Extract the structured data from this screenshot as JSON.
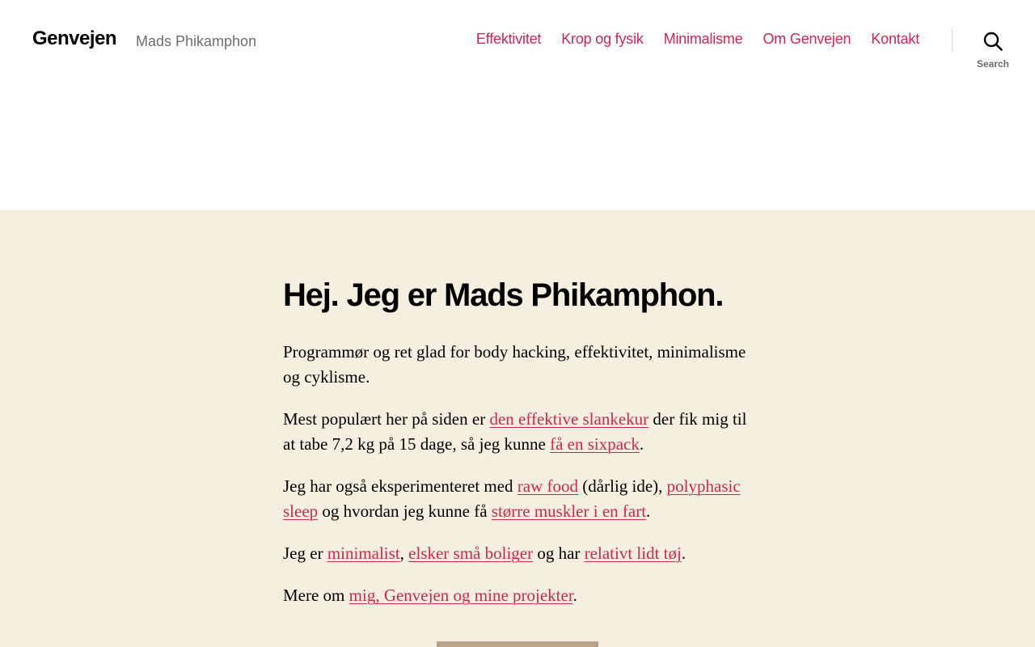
{
  "header": {
    "site_title": "Genvejen",
    "site_description": "Mads Phikamphon",
    "menu": [
      {
        "label": "Effektivitet"
      },
      {
        "label": "Krop og fysik"
      },
      {
        "label": "Minimalisme"
      },
      {
        "label": "Om Genvejen"
      },
      {
        "label": "Kontakt"
      }
    ],
    "search_label": "Search"
  },
  "main": {
    "heading": "Hej. Jeg er Mads Phikamphon.",
    "p1": {
      "text": "Programmør og ret glad for body hacking, effektivitet, minimalisme og cyklisme."
    },
    "p2": {
      "t1": "Mest populært her på siden er ",
      "link1": "den effektive slankekur",
      "t2": " der fik mig til at tabe 7,2 kg på 15 dage, så jeg kunne ",
      "link2": "få en sixpack",
      "t3": "."
    },
    "p3": {
      "t1": "Jeg har også eksperimenteret med ",
      "link1": "raw food",
      "t2": " (dårlig ide), ",
      "link2": "polyphasic sleep",
      "t3": " og hvordan jeg kunne få ",
      "link3": "større muskler i en fart",
      "t4": "."
    },
    "p4": {
      "t1": "Jeg er ",
      "link1": "minimalist",
      "t2": ", ",
      "link2": "elsker små boliger",
      "t3": " og har ",
      "link3": "relativt lidt tøj",
      "t4": "."
    },
    "p5": {
      "t1": "Mere om ",
      "link1": "mig, Genvejen og mine projekter",
      "t2": "."
    }
  },
  "colors": {
    "accent": "#cd2653",
    "content_background": "#f5efe0",
    "header_background": "#ffffff",
    "secondary_text": "#6d6d6d"
  },
  "icons": {
    "search": "search-icon"
  }
}
